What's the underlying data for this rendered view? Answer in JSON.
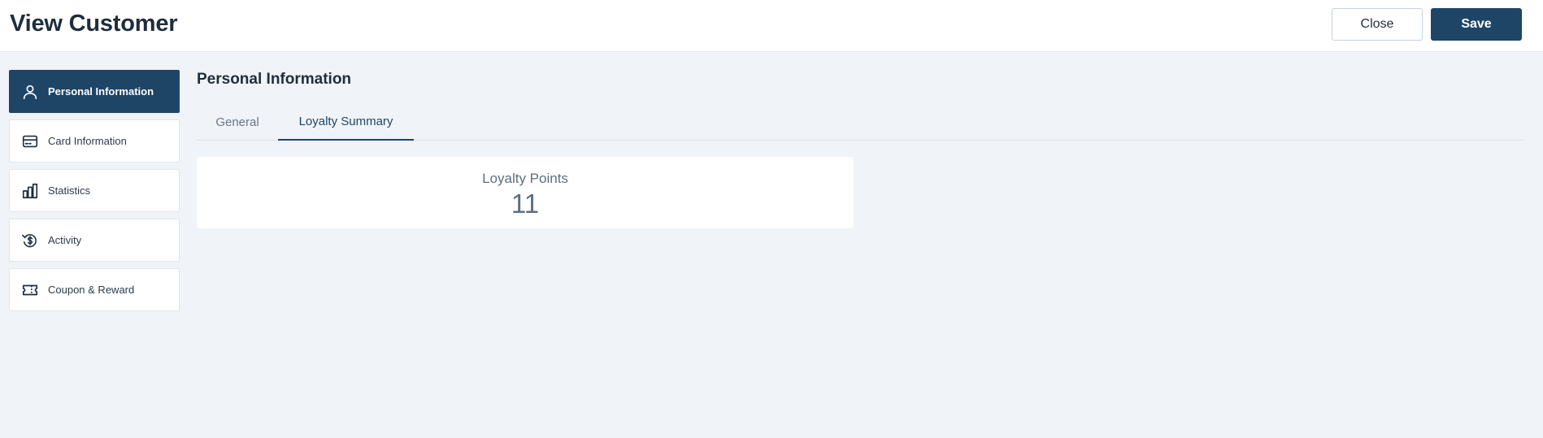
{
  "header": {
    "title": "View Customer",
    "close_label": "Close",
    "save_label": "Save"
  },
  "sidebar": {
    "items": [
      {
        "label": "Personal Information",
        "icon": "user-icon",
        "active": true
      },
      {
        "label": "Card Information",
        "icon": "credit-card-icon",
        "active": false
      },
      {
        "label": "Statistics",
        "icon": "bar-chart-icon",
        "active": false
      },
      {
        "label": "Activity",
        "icon": "dollar-cycle-icon",
        "active": false
      },
      {
        "label": "Coupon & Reward",
        "icon": "ticket-icon",
        "active": false
      }
    ]
  },
  "main": {
    "section_title": "Personal Information",
    "tabs": [
      {
        "label": "General",
        "active": false
      },
      {
        "label": "Loyalty Summary",
        "active": true
      }
    ],
    "loyalty_card": {
      "label": "Loyalty Points",
      "value": "11"
    }
  },
  "colors": {
    "primary": "#1e4566",
    "background": "#f0f3f8",
    "card": "#ffffff",
    "muted_text": "#5d6f82"
  }
}
